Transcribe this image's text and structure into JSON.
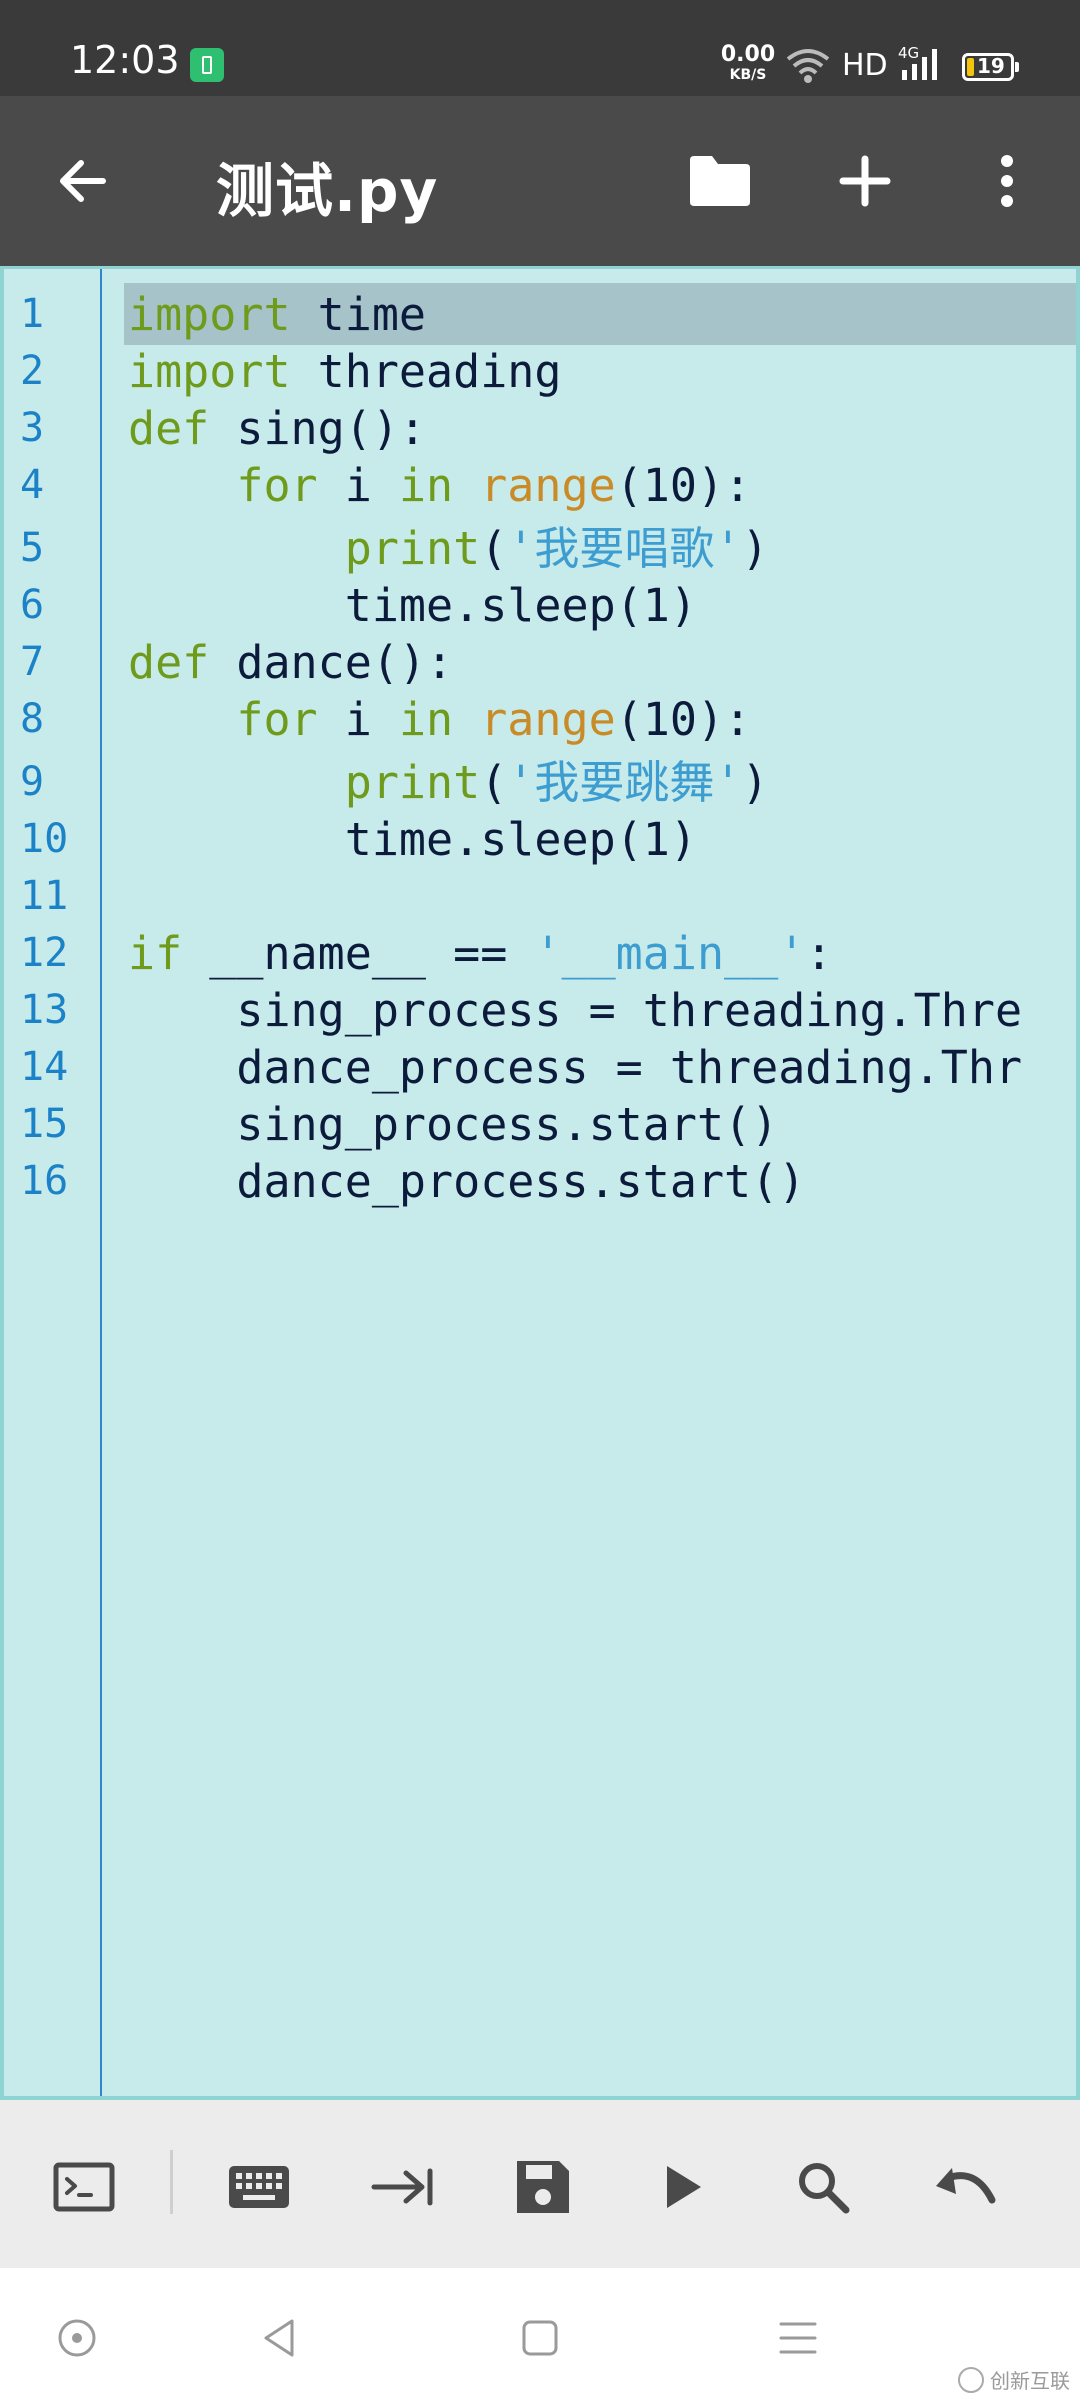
{
  "status_bar": {
    "time": "12:03",
    "net_speed_value": "0.00",
    "net_speed_unit": "KB/S",
    "hd_label": "HD",
    "network_type": "4G",
    "battery_level": "19",
    "battery_fill_color": "#f2c40c",
    "icons": [
      "battery-saver-icon",
      "wifi-icon",
      "signal-icon",
      "battery-icon"
    ]
  },
  "app_bar": {
    "title": "测试.py",
    "icons": [
      "back-arrow-icon",
      "folder-icon",
      "plus-icon",
      "more-vertical-icon"
    ]
  },
  "editor": {
    "line_numbers": [
      "1",
      "2",
      "3",
      "4",
      "5",
      "6",
      "7",
      "8",
      "9",
      "10",
      "11",
      "12",
      "13",
      "14",
      "15",
      "16"
    ],
    "lines": [
      "import time",
      "import threading",
      "def sing():",
      "    for i in range(10):",
      "        print('我要唱歌')",
      "        time.sleep(1)",
      "def dance():",
      "    for i in range(10):",
      "        print('我要跳舞')",
      "        time.sleep(1)",
      "",
      "if __name__ == '__main__':",
      "    sing_process = threading.Thre",
      "    dance_process = threading.Thr",
      "    sing_process.start()",
      "    dance_process.start()"
    ],
    "highlighted_line": 1,
    "colors": {
      "background": "#c7eaea",
      "keyword": "#6e9b1b",
      "builtin": "#c88b27",
      "string": "#3e9dd0",
      "text": "#0c1b3b",
      "line_number": "#1c82c7"
    }
  },
  "toolbar": {
    "icons": [
      "terminal-icon",
      "keyboard-icon",
      "tab-indent-icon",
      "save-icon",
      "run-icon",
      "search-icon",
      "undo-icon"
    ]
  },
  "nav_bar": {
    "icons": [
      "assistant-dot-icon",
      "back-triangle-icon",
      "home-square-icon",
      "recents-menu-icon"
    ]
  },
  "watermark": {
    "text": "创新互联"
  }
}
